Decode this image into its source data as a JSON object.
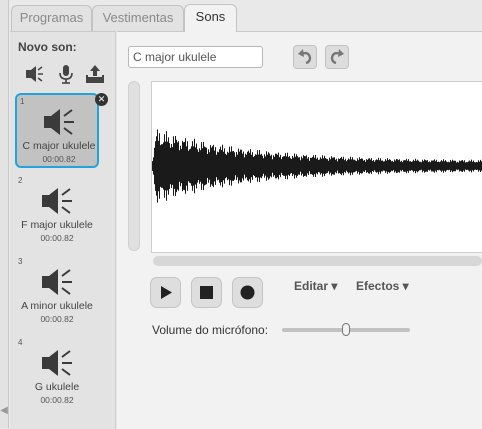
{
  "tabs": [
    {
      "label": "Programas",
      "active": false
    },
    {
      "label": "Vestimentas",
      "active": false
    },
    {
      "label": "Sons",
      "active": true
    }
  ],
  "sidebar": {
    "new_sound_label": "Novo son:",
    "tools": [
      "speaker-library-icon",
      "microphone-icon",
      "upload-icon"
    ],
    "items": [
      {
        "number": "1",
        "name": "C major ukulele",
        "duration": "00:00.82",
        "selected": true
      },
      {
        "number": "2",
        "name": "F major ukulele",
        "duration": "00:00.82",
        "selected": false
      },
      {
        "number": "3",
        "name": "A minor ukulele",
        "duration": "00:00.82",
        "selected": false
      },
      {
        "number": "4",
        "name": "G ukulele",
        "duration": "00:00.82",
        "selected": false
      }
    ]
  },
  "editor": {
    "sound_name": "C major ukulele",
    "edit_menu": "Editar ▾",
    "effects_menu": "Efectos ▾",
    "mic_volume_label": "Volume do micrófono:",
    "mic_volume": 0.5
  },
  "colors": {
    "selection": "#23a3dc",
    "waveform": "#1a1a1a"
  }
}
